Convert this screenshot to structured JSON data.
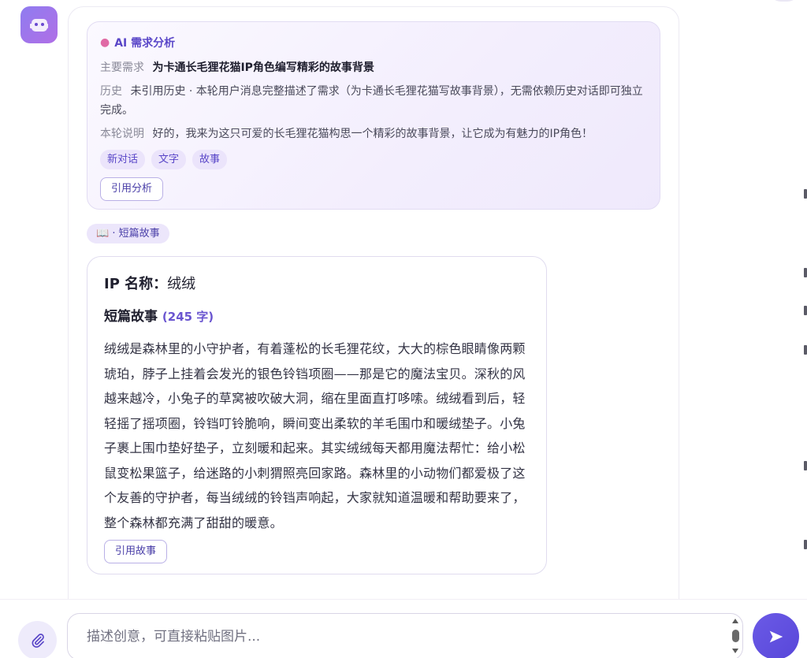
{
  "analysis": {
    "title": "AI 需求分析",
    "main_key": "主要需求",
    "main_value": "为卡通长毛狸花猫IP角色编写精彩的故事背景",
    "history_key": "历史",
    "history_value": "未引用历史 · 本轮用户消息完整描述了需求（为卡通长毛狸花猫写故事背景），无需依赖历史对话即可独立完成。",
    "note_key": "本轮说明",
    "note_value": "好的，我来为这只可爱的长毛狸花猫构思一个精彩的故事背景，让它成为有魅力的IP角色！",
    "tags": [
      "新对话",
      "文字",
      "故事"
    ],
    "ref_button": "引用分析"
  },
  "type_badge": "📖 · 短篇故事",
  "story": {
    "ip_key": "IP 名称：",
    "ip_value": "绒绒",
    "heading": "短篇故事",
    "count": "(245 字)",
    "text": "绒绒是森林里的小守护者，有着蓬松的长毛狸花纹，大大的棕色眼睛像两颗琥珀，脖子上挂着会发光的银色铃铛项圈——那是它的魔法宝贝。深秋的风越来越冷，小兔子的草窝被吹破大洞，缩在里面直打哆嗦。绒绒看到后，轻轻摇了摇项圈，铃铛叮铃脆响，瞬间变出柔软的羊毛围巾和暖绒垫子。小兔子裹上围巾垫好垫子，立刻暖和起来。其实绒绒每天都用魔法帮忙：给小松鼠变松果篮子，给迷路的小刺猬照亮回家路。森林里的小动物们都爱极了这个友善的守护者，每当绒绒的铃铛声响起，大家就知道温暖和帮助要来了，整个森林都充满了甜甜的暖意。",
    "ref_button": "引用故事"
  },
  "composer": {
    "placeholder": "描述创意，可直接粘贴图片...",
    "attach_icon": "paperclip-icon",
    "send_icon": "send-arrow-icon"
  },
  "colors": {
    "accent": "#5a47c8",
    "send": "#5847d9",
    "success": "#3cc47c"
  }
}
